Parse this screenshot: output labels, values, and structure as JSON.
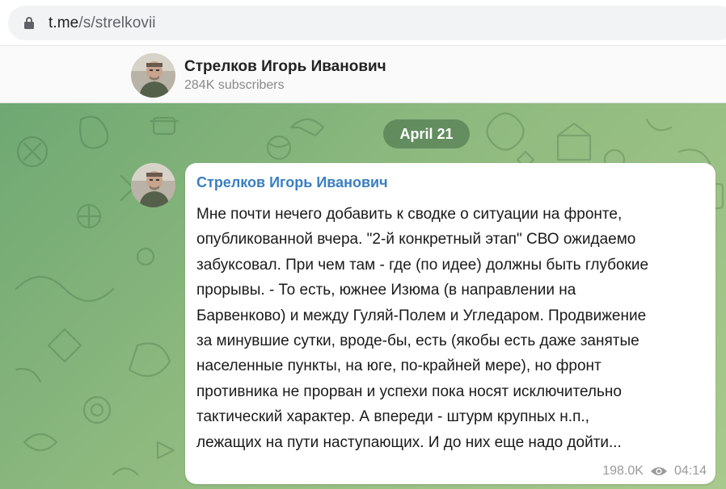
{
  "browser": {
    "url_host": "t.me",
    "url_path": "/s/strelkovii",
    "lock_icon": "lock-icon"
  },
  "channel": {
    "title": "Стрелков Игорь Иванович",
    "subscribers": "284K subscribers",
    "avatar_icon": "channel-avatar"
  },
  "chat": {
    "date_separator": "April 21",
    "message": {
      "author": "Стрелков Игорь Иванович",
      "lines": [
        "Мне почти нечего добавить к сводке о ситуации на фронте,",
        "опубликованной вчера. \"2-й конкретный этап\" СВО ожидаемо",
        "забуксовал. При чем там - где (по идее) должны быть глубокие",
        "прорывы. - То есть, южнее Изюма (в направлении на",
        "Барвенково) и между Гуляй-Полем и Угледаром. Продвижение",
        "за минувшие сутки, вроде-бы, есть (якобы есть даже занятые",
        "населенные пункты, на юге, по-крайней мере), но фронт",
        "противника не прорван и успехи пока носят исключительно",
        "тактический характер. А впереди - штурм крупных н.п.,",
        "лежащих на пути наступающих. И до них еще надо дойти..."
      ],
      "views": "198.0K",
      "time": "04:14",
      "views_icon": "eye-icon"
    }
  },
  "colors": {
    "author_link": "#3a7fc1",
    "chat_background": "#8fba7f",
    "date_pill": "#4f7d55"
  }
}
